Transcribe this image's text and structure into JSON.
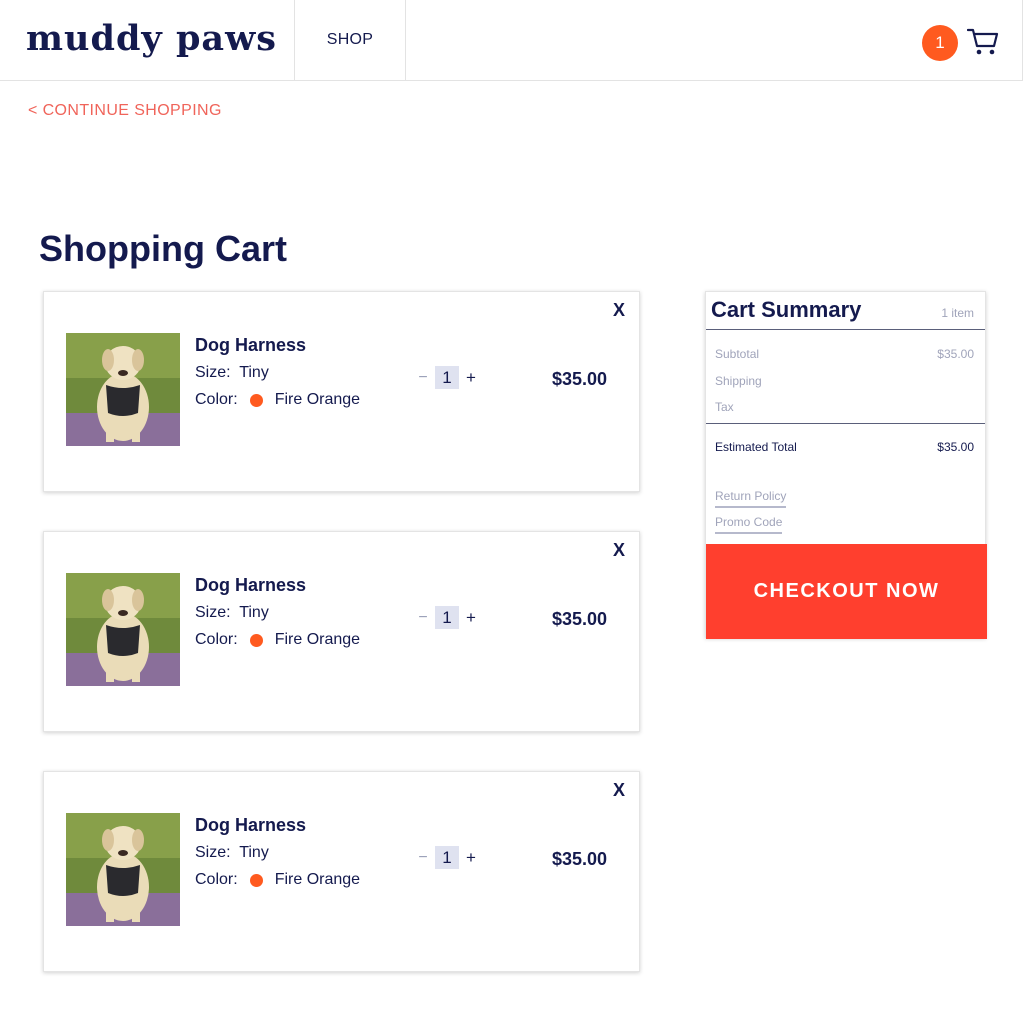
{
  "brand": {
    "logo": "muddy paws"
  },
  "nav": {
    "shop_label": "SHOP"
  },
  "header": {
    "cart_count": "1"
  },
  "continue_label": "< CONTINUE SHOPPING",
  "page_title": "Shopping Cart",
  "cart_items": [
    {
      "name": "Dog Harness",
      "size_label": "Size:",
      "size_value": "Tiny",
      "color_label": "Color:",
      "color_value": "Fire Orange",
      "color_hex": "#ff5a1f",
      "quantity": "1",
      "minus": "−",
      "plus": "+",
      "price": "$35.00",
      "remove": "X"
    },
    {
      "name": "Dog Harness",
      "size_label": "Size:",
      "size_value": "Tiny",
      "color_label": "Color:",
      "color_value": "Fire Orange",
      "color_hex": "#ff5a1f",
      "quantity": "1",
      "minus": "−",
      "plus": "+",
      "price": "$35.00",
      "remove": "X"
    },
    {
      "name": "Dog Harness",
      "size_label": "Size:",
      "size_value": "Tiny",
      "color_label": "Color:",
      "color_value": "Fire Orange",
      "color_hex": "#ff5a1f",
      "quantity": "1",
      "minus": "−",
      "plus": "+",
      "price": "$35.00",
      "remove": "X"
    }
  ],
  "summary": {
    "title": "Cart Summary",
    "item_count": "1 item",
    "subtotal_label": "Subtotal",
    "subtotal_value": "$35.00",
    "shipping_label": "Shipping",
    "tax_label": "Tax",
    "total_label": "Estimated Total",
    "total_value": "$35.00",
    "return_policy": "Return Policy",
    "promo_code": "Promo Code",
    "checkout_label": "CHECKOUT NOW"
  },
  "colors": {
    "navy": "#141a4e",
    "accent_orange": "#ff5a1f",
    "checkout_red": "#ff3f2e",
    "link_coral": "#f0645a"
  },
  "icons": [
    "cart-icon",
    "dog-photo"
  ]
}
